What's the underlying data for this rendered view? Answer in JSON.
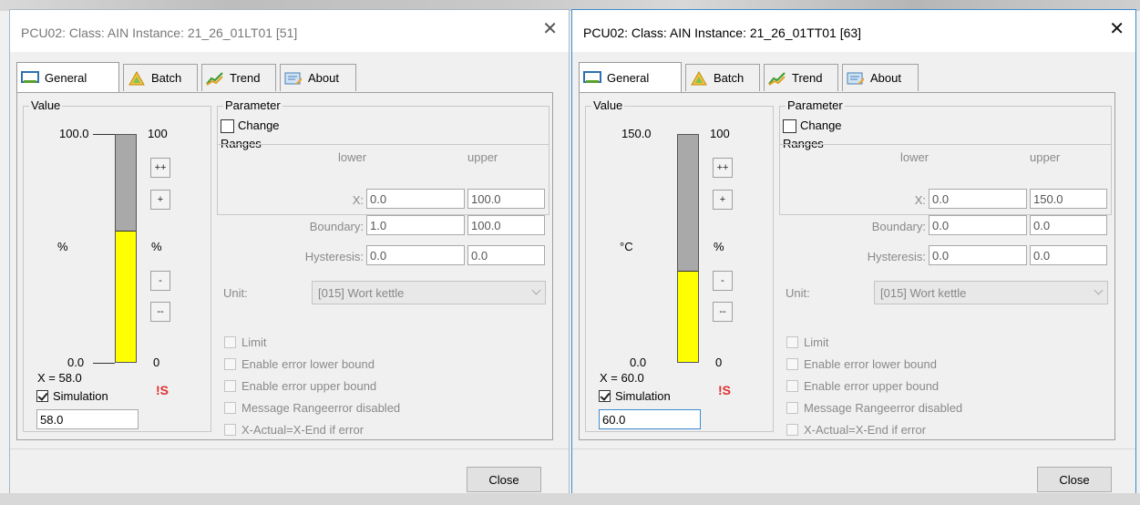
{
  "windows": [
    {
      "title": "PCU02: Class: AIN Instance: 21_26_01LT01 [51]",
      "tabs": [
        "General",
        "Batch",
        "Trend",
        "About"
      ],
      "value_group_label": "Value",
      "scale_max": "100.0",
      "scale_min": "0.0",
      "right_max": "100",
      "right_min": "0",
      "unit_left": "%",
      "unit_right": "%",
      "fill_fraction": 0.58,
      "buttons": [
        "++",
        "+",
        "-",
        "--"
      ],
      "x_readout": "X = 58.0",
      "simulation_label": "Simulation",
      "simulation_checked": true,
      "simulation_value": "58.0",
      "error_flag": "!S",
      "parameter_label": "Parameter",
      "change_label": "Change",
      "ranges_label": "Ranges",
      "lower_label": "lower",
      "upper_label": "upper",
      "rows": [
        {
          "label": "X:",
          "lower": "0.0",
          "upper": "100.0"
        },
        {
          "label": "Boundary:",
          "lower": "1.0",
          "upper": "100.0"
        },
        {
          "label": "Hysteresis:",
          "lower": "0.0",
          "upper": "0.0"
        }
      ],
      "unit_label": "Unit:",
      "unit_value": "[015] Wort kettle",
      "checks": [
        "Limit",
        "Enable error lower bound",
        "Enable error upper bound",
        "Message Rangeerror disabled",
        "X-Actual=X-End if error"
      ],
      "close_label": "Close"
    },
    {
      "title": "PCU02: Class: AIN Instance: 21_26_01TT01 [63]",
      "tabs": [
        "General",
        "Batch",
        "Trend",
        "About"
      ],
      "value_group_label": "Value",
      "scale_max": "150.0",
      "scale_min": "0.0",
      "right_max": "100",
      "right_min": "0",
      "unit_left": "°C",
      "unit_right": "%",
      "fill_fraction": 0.4,
      "buttons": [
        "++",
        "+",
        "-",
        "--"
      ],
      "x_readout": "X = 60.0",
      "simulation_label": "Simulation",
      "simulation_checked": true,
      "simulation_value": "60.0",
      "error_flag": "!S",
      "parameter_label": "Parameter",
      "change_label": "Change",
      "ranges_label": "Ranges",
      "lower_label": "lower",
      "upper_label": "upper",
      "rows": [
        {
          "label": "X:",
          "lower": "0.0",
          "upper": "150.0"
        },
        {
          "label": "Boundary:",
          "lower": "0.0",
          "upper": "0.0"
        },
        {
          "label": "Hysteresis:",
          "lower": "0.0",
          "upper": "0.0"
        }
      ],
      "unit_label": "Unit:",
      "unit_value": "[015] Wort kettle",
      "checks": [
        "Limit",
        "Enable error lower bound",
        "Enable error upper bound",
        "Message Rangeerror disabled",
        "X-Actual=X-End if error"
      ],
      "close_label": "Close"
    }
  ],
  "colors": {
    "gauge_fill": "#ffff00",
    "gauge_empty": "#a9a9a9",
    "error_flag": "#e03030",
    "active_border": "#3c8bd0"
  }
}
